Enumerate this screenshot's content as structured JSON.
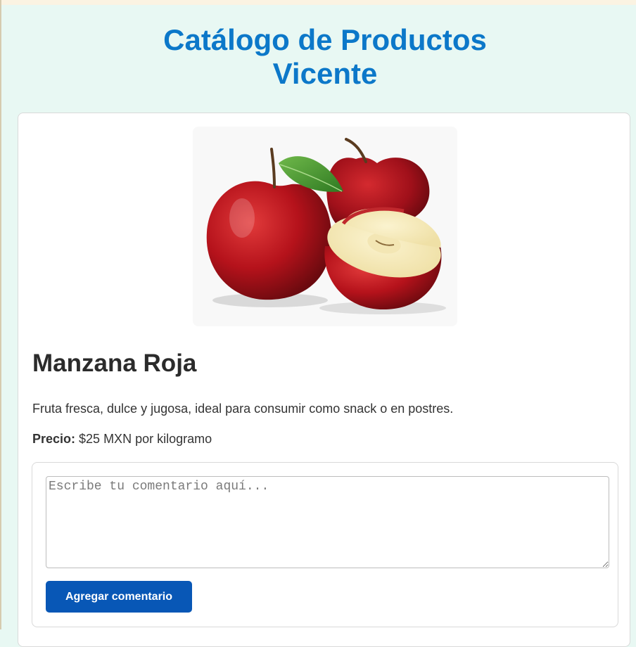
{
  "page": {
    "title_line1": "Catálogo de Productos",
    "title_line2": "Vicente"
  },
  "colors": {
    "title": "#0c78c9",
    "background": "#e8f8f3",
    "button": "#0857b6",
    "apple_red": "#b5121b",
    "leaf_green": "#3f8f2a"
  },
  "product": {
    "image_icon": "red-apples-image",
    "name": "Manzana Roja",
    "description": "Fruta fresca, dulce y jugosa, ideal para consumir como snack o en postres.",
    "price_label": "Precio:",
    "price_value": " $25 MXN por kilogramo"
  },
  "comments": {
    "placeholder": "Escribe tu comentario aquí...",
    "value": "",
    "button_label": "Agregar comentario"
  }
}
